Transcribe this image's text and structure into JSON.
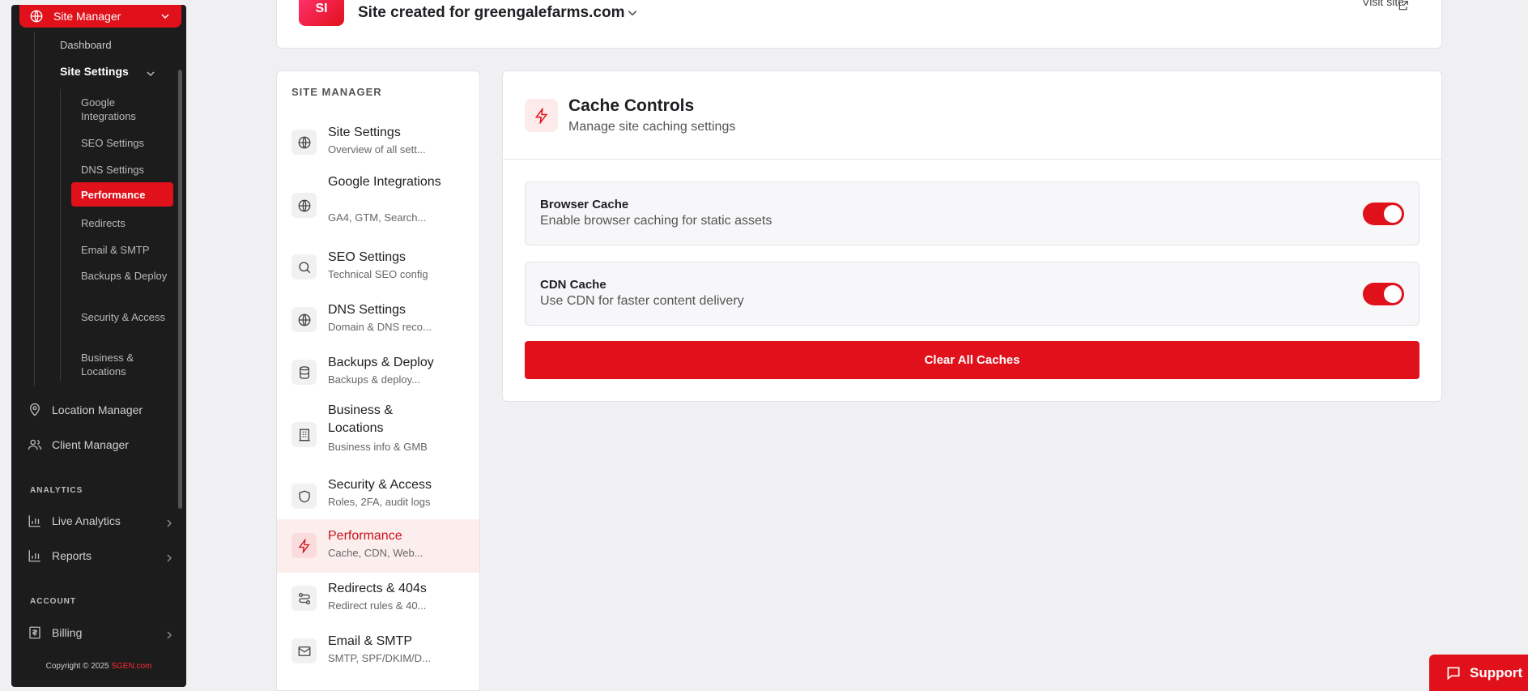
{
  "sidebar": {
    "top_label": "Site Manager",
    "dashboard": "Dashboard",
    "site_settings": "Site Settings",
    "sub_items": [
      {
        "label": "Google Integrations"
      },
      {
        "label": "SEO Settings"
      },
      {
        "label": "DNS Settings"
      },
      {
        "label": "Performance"
      },
      {
        "label": "Redirects"
      },
      {
        "label": "Email & SMTP"
      },
      {
        "label": "Backups & Deploy"
      },
      {
        "label": "Security & Access"
      },
      {
        "label": "Business & Locations"
      }
    ],
    "location_manager": "Location Manager",
    "client_manager": "Client Manager",
    "analytics_heading": "ANALYTICS",
    "live_analytics": "Live Analytics",
    "reports": "Reports",
    "account_heading": "ACCOUNT",
    "billing": "Billing",
    "copyright": "Copyright © 2025",
    "brand": "SGEN.com"
  },
  "header": {
    "avatar_initials": "SI",
    "site_name": "Site created for greengalefarms.com",
    "visit_label": "Visit site"
  },
  "nav_panel": {
    "title": "SITE MANAGER",
    "items": [
      {
        "title": "Site Settings",
        "subtitle": "Overview of all sett..."
      },
      {
        "title": "Google Integrations",
        "subtitle": "GA4, GTM, Search..."
      },
      {
        "title": "SEO Settings",
        "subtitle": "Technical SEO config"
      },
      {
        "title": "DNS Settings",
        "subtitle": "Domain & DNS reco..."
      },
      {
        "title": "Backups & Deploy",
        "subtitle": "Backups & deploy..."
      },
      {
        "title": "Business & Locations",
        "subtitle": "Business info & GMB"
      },
      {
        "title": "Security & Access",
        "subtitle": "Roles, 2FA, audit logs"
      },
      {
        "title": "Performance",
        "subtitle": "Cache, CDN, Web..."
      },
      {
        "title": "Redirects & 404s",
        "subtitle": "Redirect rules & 40..."
      },
      {
        "title": "Email & SMTP",
        "subtitle": "SMTP, SPF/DKIM/D..."
      }
    ]
  },
  "main": {
    "title": "Cache Controls",
    "subtitle": "Manage site caching settings",
    "browser_cache": {
      "title": "Browser Cache",
      "subtitle": "Enable browser caching for static assets",
      "enabled": true
    },
    "cdn_cache": {
      "title": "CDN Cache",
      "subtitle": "Use CDN for faster content delivery",
      "enabled": true
    },
    "clear_button": "Clear All Caches"
  },
  "support_label": "Support",
  "colors": {
    "accent": "#e0111b",
    "sidebar_bg": "#1c1c1c",
    "page_bg": "#f0f0f2"
  }
}
